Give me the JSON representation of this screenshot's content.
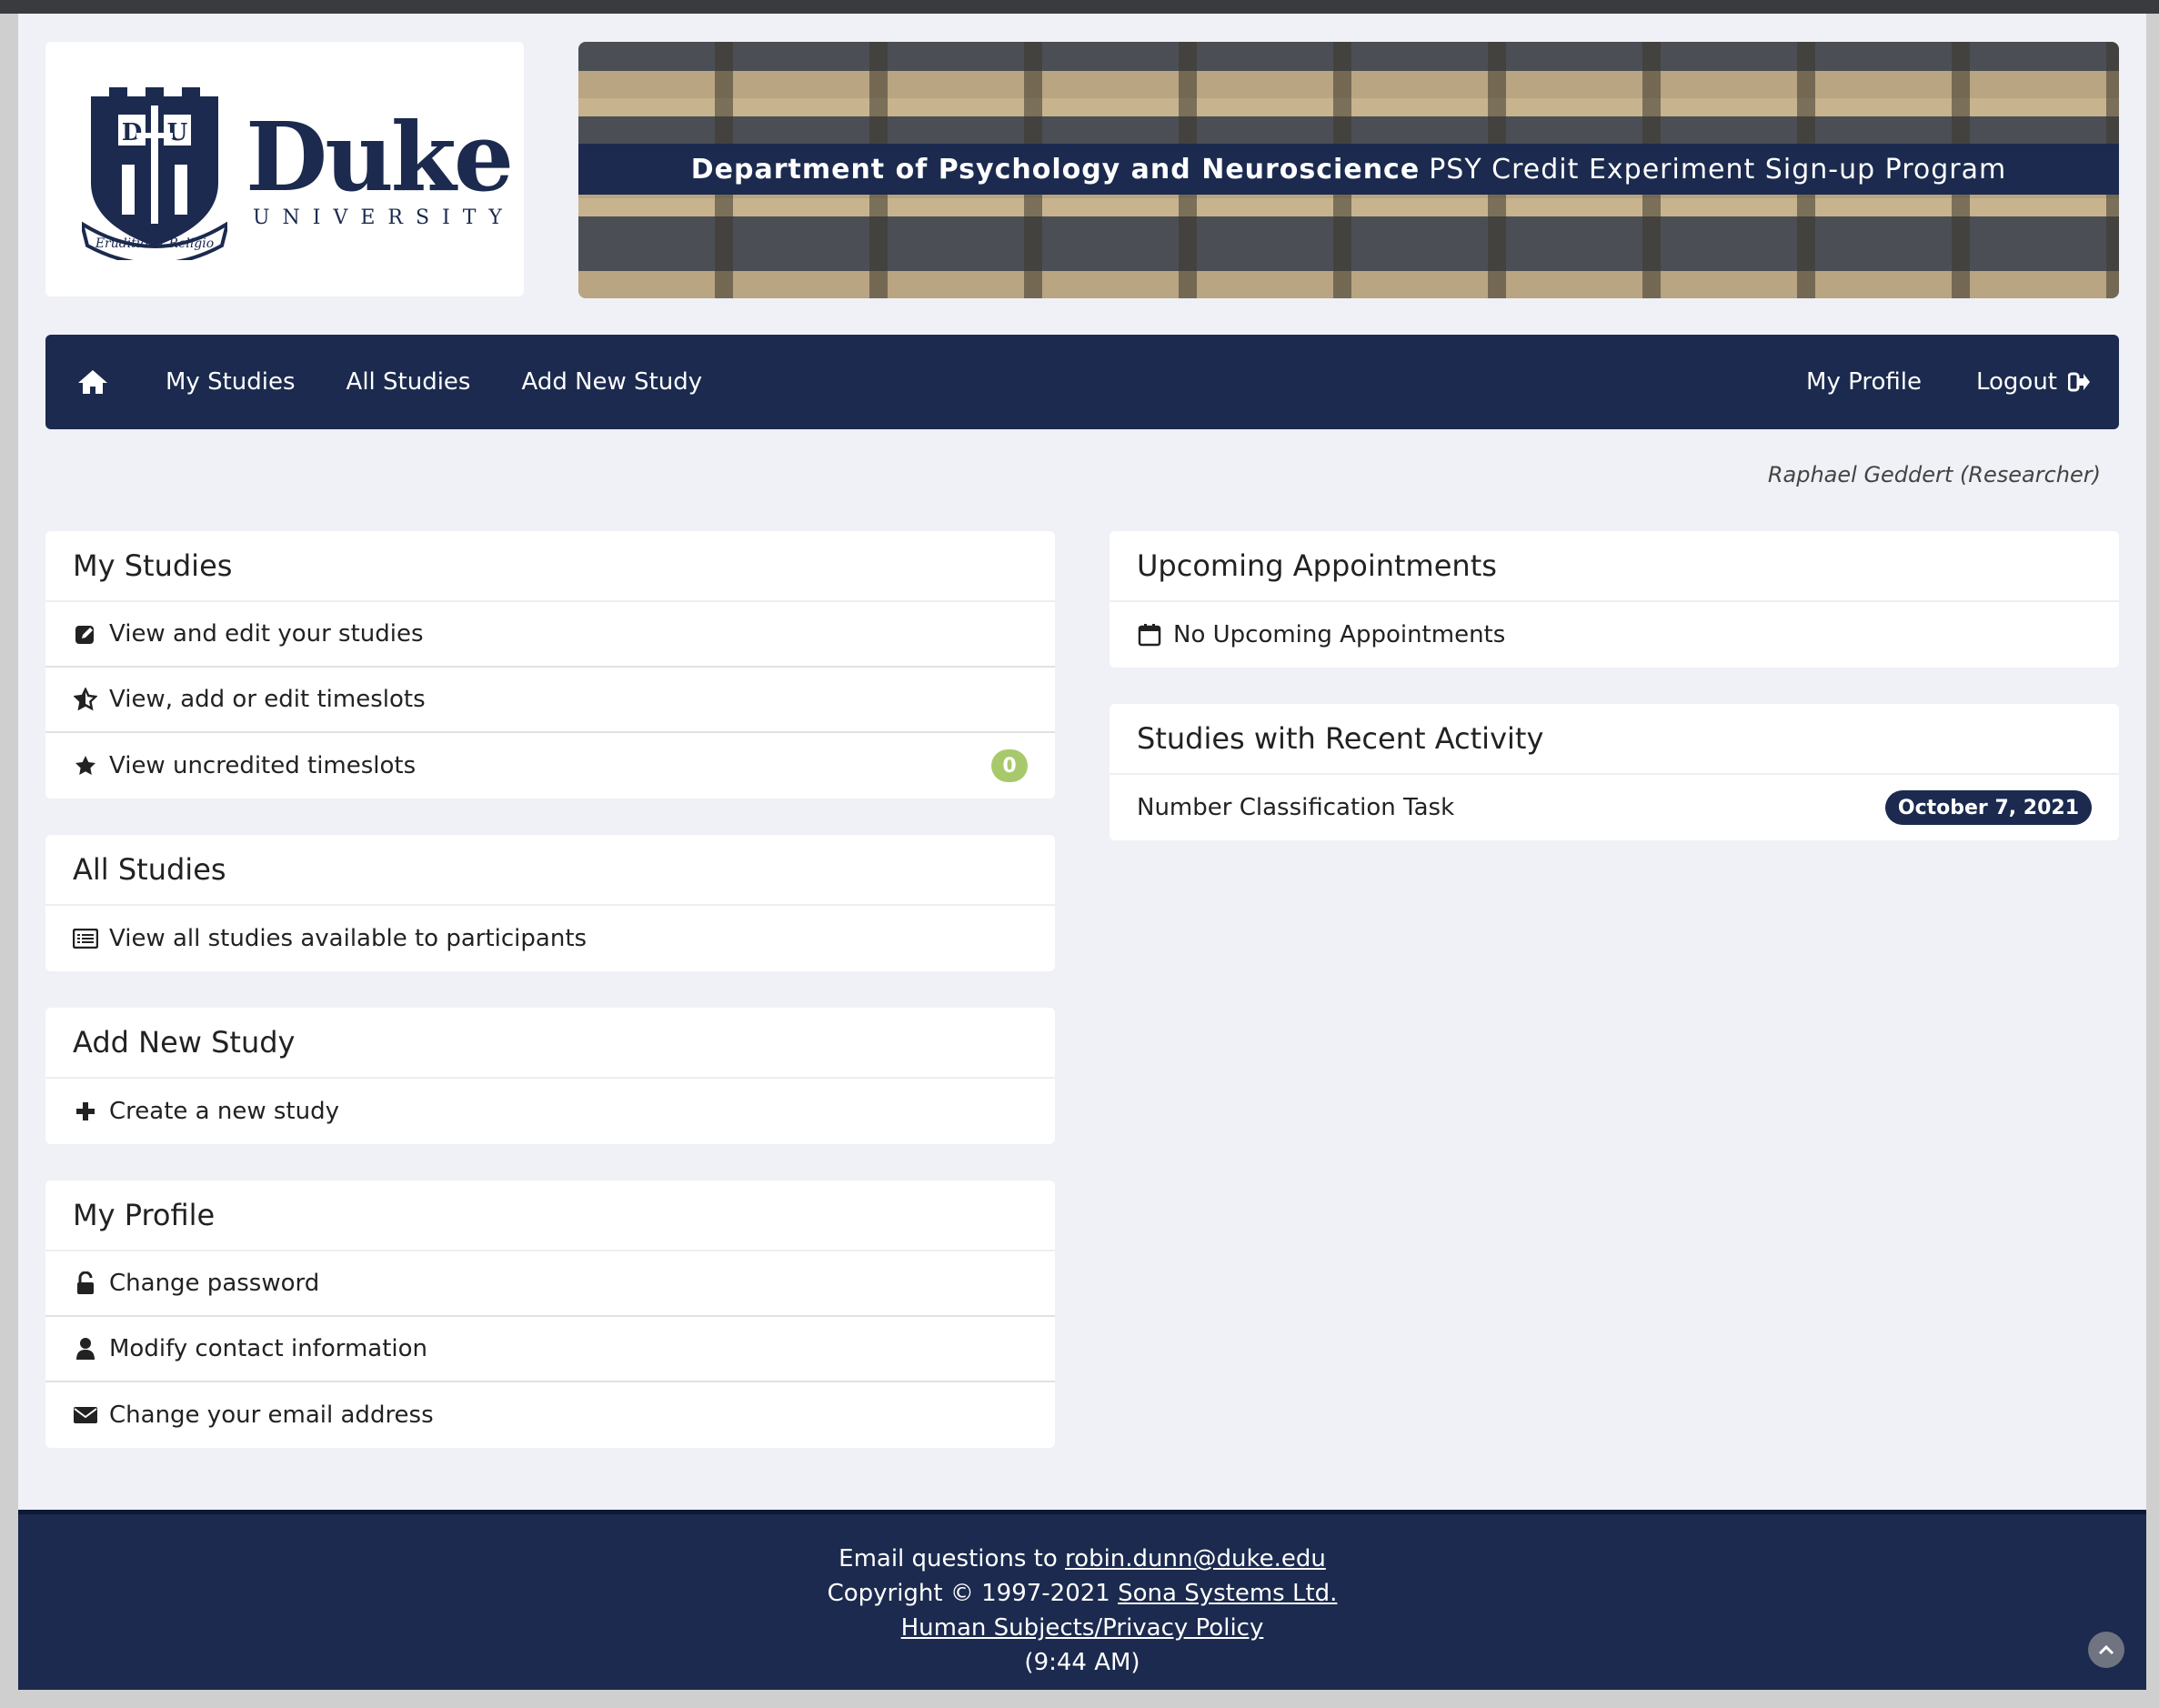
{
  "header": {
    "logo_name": "Duke",
    "logo_sub": "UNIVERSITY",
    "banner_dept": "Department of Psychology and Neuroscience",
    "banner_program": "PSY Credit Experiment Sign-up Program"
  },
  "nav": {
    "home_icon": "home-icon",
    "items": [
      {
        "label": "My Studies"
      },
      {
        "label": "All Studies"
      },
      {
        "label": "Add New Study"
      }
    ],
    "my_profile": "My Profile",
    "logout": "Logout"
  },
  "user": "Raphael Geddert (Researcher)",
  "panels": {
    "my_studies": {
      "title": "My Studies",
      "rows": [
        {
          "label": "View and edit your studies",
          "icon": "edit-icon"
        },
        {
          "label": "View, add or edit timeslots",
          "icon": "star-half-icon"
        },
        {
          "label": "View uncredited timeslots",
          "icon": "star-icon",
          "badge": "0"
        }
      ]
    },
    "all_studies": {
      "title": "All Studies",
      "rows": [
        {
          "label": "View all studies available to participants",
          "icon": "list-icon"
        }
      ]
    },
    "add_new_study": {
      "title": "Add New Study",
      "rows": [
        {
          "label": "Create a new study",
          "icon": "plus-icon"
        }
      ]
    },
    "my_profile": {
      "title": "My Profile",
      "rows": [
        {
          "label": "Change password",
          "icon": "unlock-icon"
        },
        {
          "label": "Modify contact information",
          "icon": "user-icon"
        },
        {
          "label": "Change your email address",
          "icon": "envelope-icon"
        }
      ]
    },
    "upcoming": {
      "title": "Upcoming Appointments",
      "rows": [
        {
          "label": "No Upcoming Appointments",
          "icon": "calendar-icon"
        }
      ]
    },
    "recent": {
      "title": "Studies with Recent Activity",
      "rows": [
        {
          "label": "Number Classification Task",
          "date": "October 7, 2021"
        }
      ]
    }
  },
  "footer": {
    "email_prefix": "Email questions to ",
    "email": "robin.dunn@duke.edu",
    "copyright_prefix": "Copyright © 1997-2021 ",
    "company": "Sona Systems Ltd.",
    "policy": "Human Subjects/Privacy Policy",
    "time": "(9:44 AM)"
  },
  "colors": {
    "navy": "#1b2a4e",
    "badge_green": "#a8c96b",
    "page_bg": "#f0f1f6"
  }
}
